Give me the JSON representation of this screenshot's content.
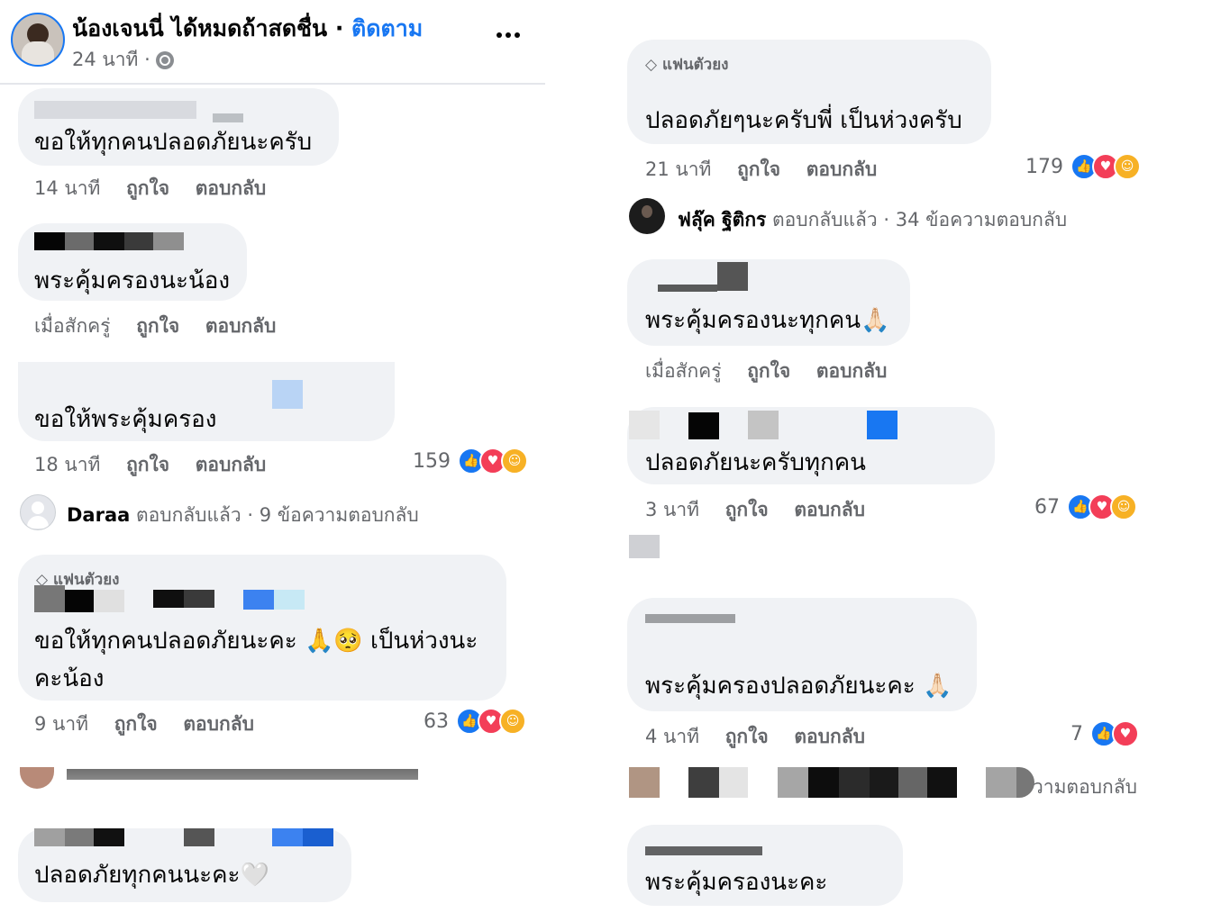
{
  "header": {
    "page_name": "น้องเจนนี่ ได้หมดถ้าสดชื่น",
    "follow_label": "ติดตาม",
    "time": "24 นาที ·",
    "more_icon": "ellipsis-icon",
    "globe_icon": "globe-icon"
  },
  "actions": {
    "like": "ถูกใจ",
    "reply": "ตอบกลับ"
  },
  "left_comments": [
    {
      "text": "ขอให้ทุกคนปลอดภัยนะครับ",
      "time": "14 นาที"
    },
    {
      "text": "พระคุ้มครองนะน้อง",
      "time": "เมื่อสักครู่"
    },
    {
      "text": "ขอให้พระคุ้มครอง",
      "time": "18 นาที",
      "reactions": "159"
    },
    {
      "text_line1": "ขอให้ทุกคนปลอดภัยนะคะ 🙏🥺 เป็นห่วงนะ",
      "text_line2": "คะน้อง",
      "time": "9 นาที",
      "reactions": "63",
      "badge": "แฟนตัวยง"
    },
    {
      "text": "ปลอดภัยทุกคนนะคะ🤍"
    }
  ],
  "left_reply_summary": {
    "name": "Daraa",
    "text": "ตอบกลับแล้ว · 9 ข้อความตอบกลับ"
  },
  "right_comments": [
    {
      "badge": "แฟนตัวยง",
      "text": "ปลอดภัยๆนะครับพี่ เป็นห่วงครับ",
      "time": "21 นาที",
      "reactions": "179"
    },
    {
      "text": "พระคุ้มครองนะทุกคน🙏🏻",
      "time": "เมื่อสักครู่"
    },
    {
      "text": "ปลอดภัยนะครับทุกคน",
      "time": "3 นาที",
      "reactions": "67"
    },
    {
      "text": "พระคุ้มครองปลอดภัยนะคะ 🙏🏻",
      "time": "4 นาที",
      "reactions": "7"
    },
    {
      "text": "พระคุ้มครองนะคะ"
    }
  ],
  "right_reply_summary": {
    "name": "ฟลุ๊ค ฐิติกร",
    "text": "ตอบกลับแล้ว · 34 ข้อความตอบกลับ"
  },
  "right_reply_summary2": {
    "text": "วามตอบกลับ"
  },
  "colors": {
    "like": "#1877f2",
    "love": "#f33e58",
    "care": "#f7b125",
    "follow": "#1877f2",
    "bubble": "#f0f2f5"
  }
}
